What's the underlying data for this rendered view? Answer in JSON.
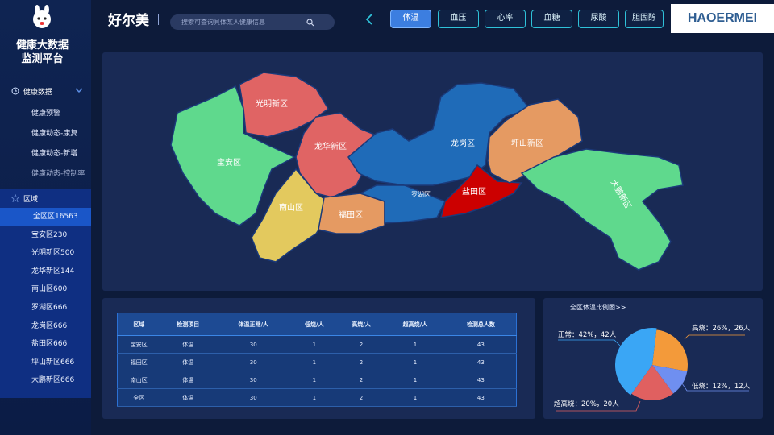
{
  "app": {
    "title": "健康大数据\n监测平台",
    "brand": "好尔美",
    "badge": "HAOERMEI"
  },
  "search": {
    "placeholder": "搜索可查询具体某人健康信息"
  },
  "tabs": [
    {
      "label": "体温",
      "active": true
    },
    {
      "label": "血压",
      "active": false
    },
    {
      "label": "心率",
      "active": false
    },
    {
      "label": "血糖",
      "active": false
    },
    {
      "label": "尿酸",
      "active": false
    },
    {
      "label": "胆固醇",
      "active": false
    }
  ],
  "sidebar": {
    "health_section": "健康数据",
    "health_items": [
      "健康预警",
      "健康动态-康复",
      "健康动态-新增",
      "健康动态-控制率"
    ],
    "region_section": "区域",
    "region_items": [
      "全区区16563",
      "宝安区230",
      "光明新区500",
      "龙华新区144",
      "南山区600",
      "罗湖区666",
      "龙岗区666",
      "盐田区666",
      "坪山新区666",
      "大鹏新区666"
    ]
  },
  "map": {
    "districts": [
      {
        "name": "光明新区",
        "color": "#e06464"
      },
      {
        "name": "宝安区",
        "color": "#5fd98d"
      },
      {
        "name": "龙华新区",
        "color": "#e06464"
      },
      {
        "name": "南山区",
        "color": "#e3c95e"
      },
      {
        "name": "福田区",
        "color": "#e59a62"
      },
      {
        "name": "罗湖区",
        "color": "#1f6bb8"
      },
      {
        "name": "龙岗区",
        "color": "#1f6bb8"
      },
      {
        "name": "盐田区",
        "color": "#cc0000"
      },
      {
        "name": "坪山新区",
        "color": "#e59a62"
      },
      {
        "name": "大鹏新区",
        "color": "#5fd98d"
      }
    ]
  },
  "table": {
    "headers": [
      "区域",
      "检测项目",
      "体温正常/人",
      "低烧/人",
      "高烧/人",
      "超高烧/人",
      "检测总人数"
    ],
    "rows": [
      [
        "宝安区",
        "体温",
        "30",
        "1",
        "2",
        "1",
        "43"
      ],
      [
        "福田区",
        "体温",
        "30",
        "1",
        "2",
        "1",
        "43"
      ],
      [
        "南山区",
        "体温",
        "30",
        "1",
        "2",
        "1",
        "43"
      ],
      [
        "全区",
        "体温",
        "30",
        "1",
        "2",
        "1",
        "43"
      ]
    ]
  },
  "pie": {
    "title": "全区体温比例图>>",
    "slices": [
      {
        "label": "高烧：26%，26人",
        "value": 26,
        "color": "#f39a3a"
      },
      {
        "label": "低烧：12%，12人",
        "value": 12,
        "color": "#6f8ff0"
      },
      {
        "label": "超高烧：20%，20人",
        "value": 20,
        "color": "#e06060"
      },
      {
        "label": "正常：42%，42人",
        "value": 42,
        "color": "#3aa6f5"
      }
    ]
  },
  "chart_data": {
    "type": "pie",
    "title": "全区体温比例图>>",
    "categories": [
      "高烧",
      "低烧",
      "超高烧",
      "正常"
    ],
    "values": [
      26,
      12,
      20,
      42
    ]
  }
}
